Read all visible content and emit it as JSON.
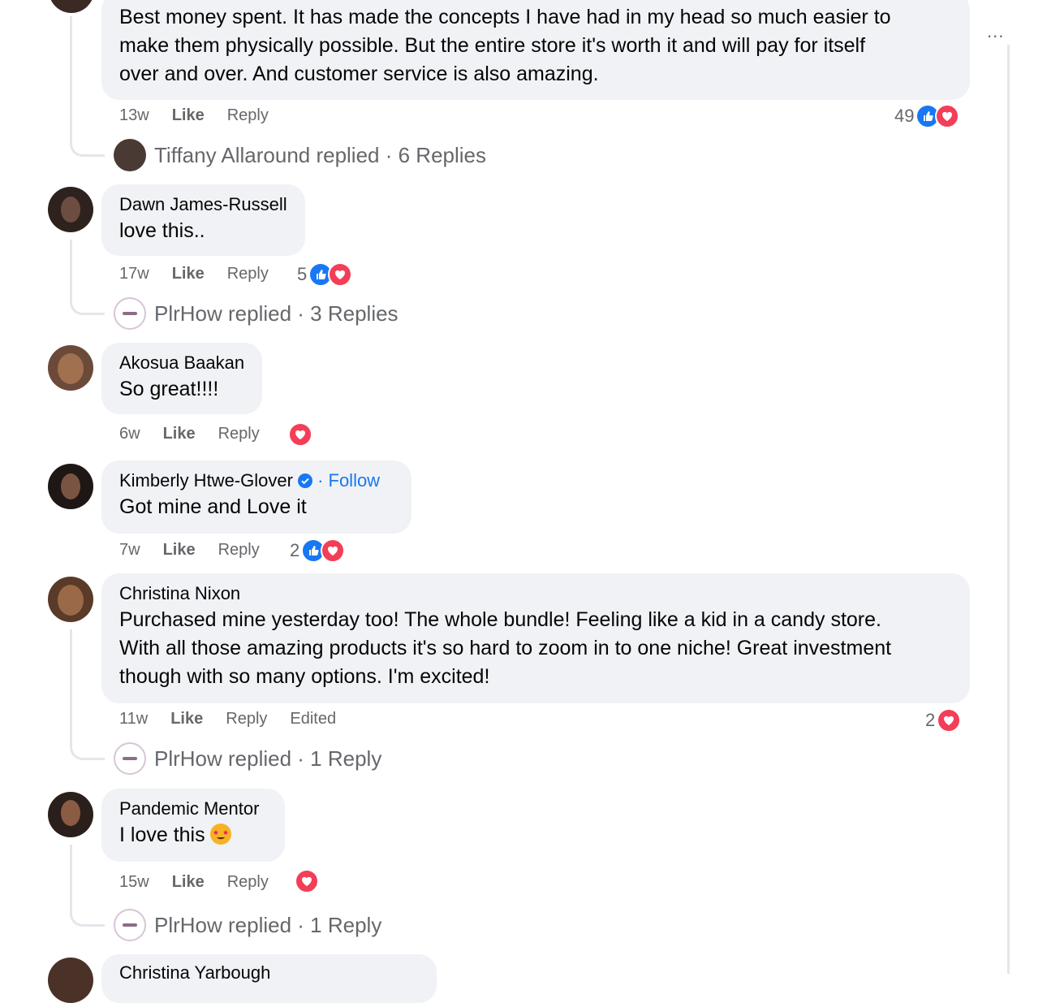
{
  "top_comment": {
    "text_lines": [
      "Best money spent. It has made the concepts I have had in my head so much easier to",
      "make them physically possible. But the entire store it's worth it and will pay for itself",
      "over and over. And customer service is also amazing."
    ],
    "time": "13w",
    "like": "Like",
    "reply": "Reply",
    "reaction_count": "49",
    "replied": "Tiffany Allaround replied · 6 Replies"
  },
  "comments": [
    {
      "author": "Dawn James-Russell",
      "text": "love this..",
      "time": "17w",
      "like": "Like",
      "reply": "Reply",
      "reaction_count": "5",
      "replied": "PlrHow replied · 3 Replies"
    },
    {
      "author": "Akosua Baakan",
      "text": "So great!!!!",
      "time": "6w",
      "like": "Like",
      "reply": "Reply"
    },
    {
      "author": "Kimberly Htwe-Glover",
      "follow": "· Follow",
      "text": "Got mine and Love it",
      "time": "7w",
      "like": "Like",
      "reply": "Reply",
      "reaction_count": "2"
    },
    {
      "author": "Christina Nixon",
      "text_lines": [
        "Purchased mine yesterday too! The whole bundle! Feeling like a kid in a candy store.",
        "With all those amazing products it's so hard to zoom in to one niche! Great investment",
        "though with so many options. I'm excited!"
      ],
      "time": "11w",
      "like": "Like",
      "reply": "Reply",
      "edited": "Edited",
      "reaction_count": "2",
      "replied": "PlrHow replied · 1 Reply"
    },
    {
      "author": "Pandemic Mentor",
      "text": "I love this",
      "time": "15w",
      "like": "Like",
      "reply": "Reply",
      "replied": "PlrHow replied · 1 Reply"
    },
    {
      "author": "Christina Yarbough"
    }
  ],
  "more_options": "...",
  "colors": {
    "like": "#1877f2",
    "love": "#f33e58",
    "bubble": "#f0f2f5",
    "meta": "#65676b"
  }
}
